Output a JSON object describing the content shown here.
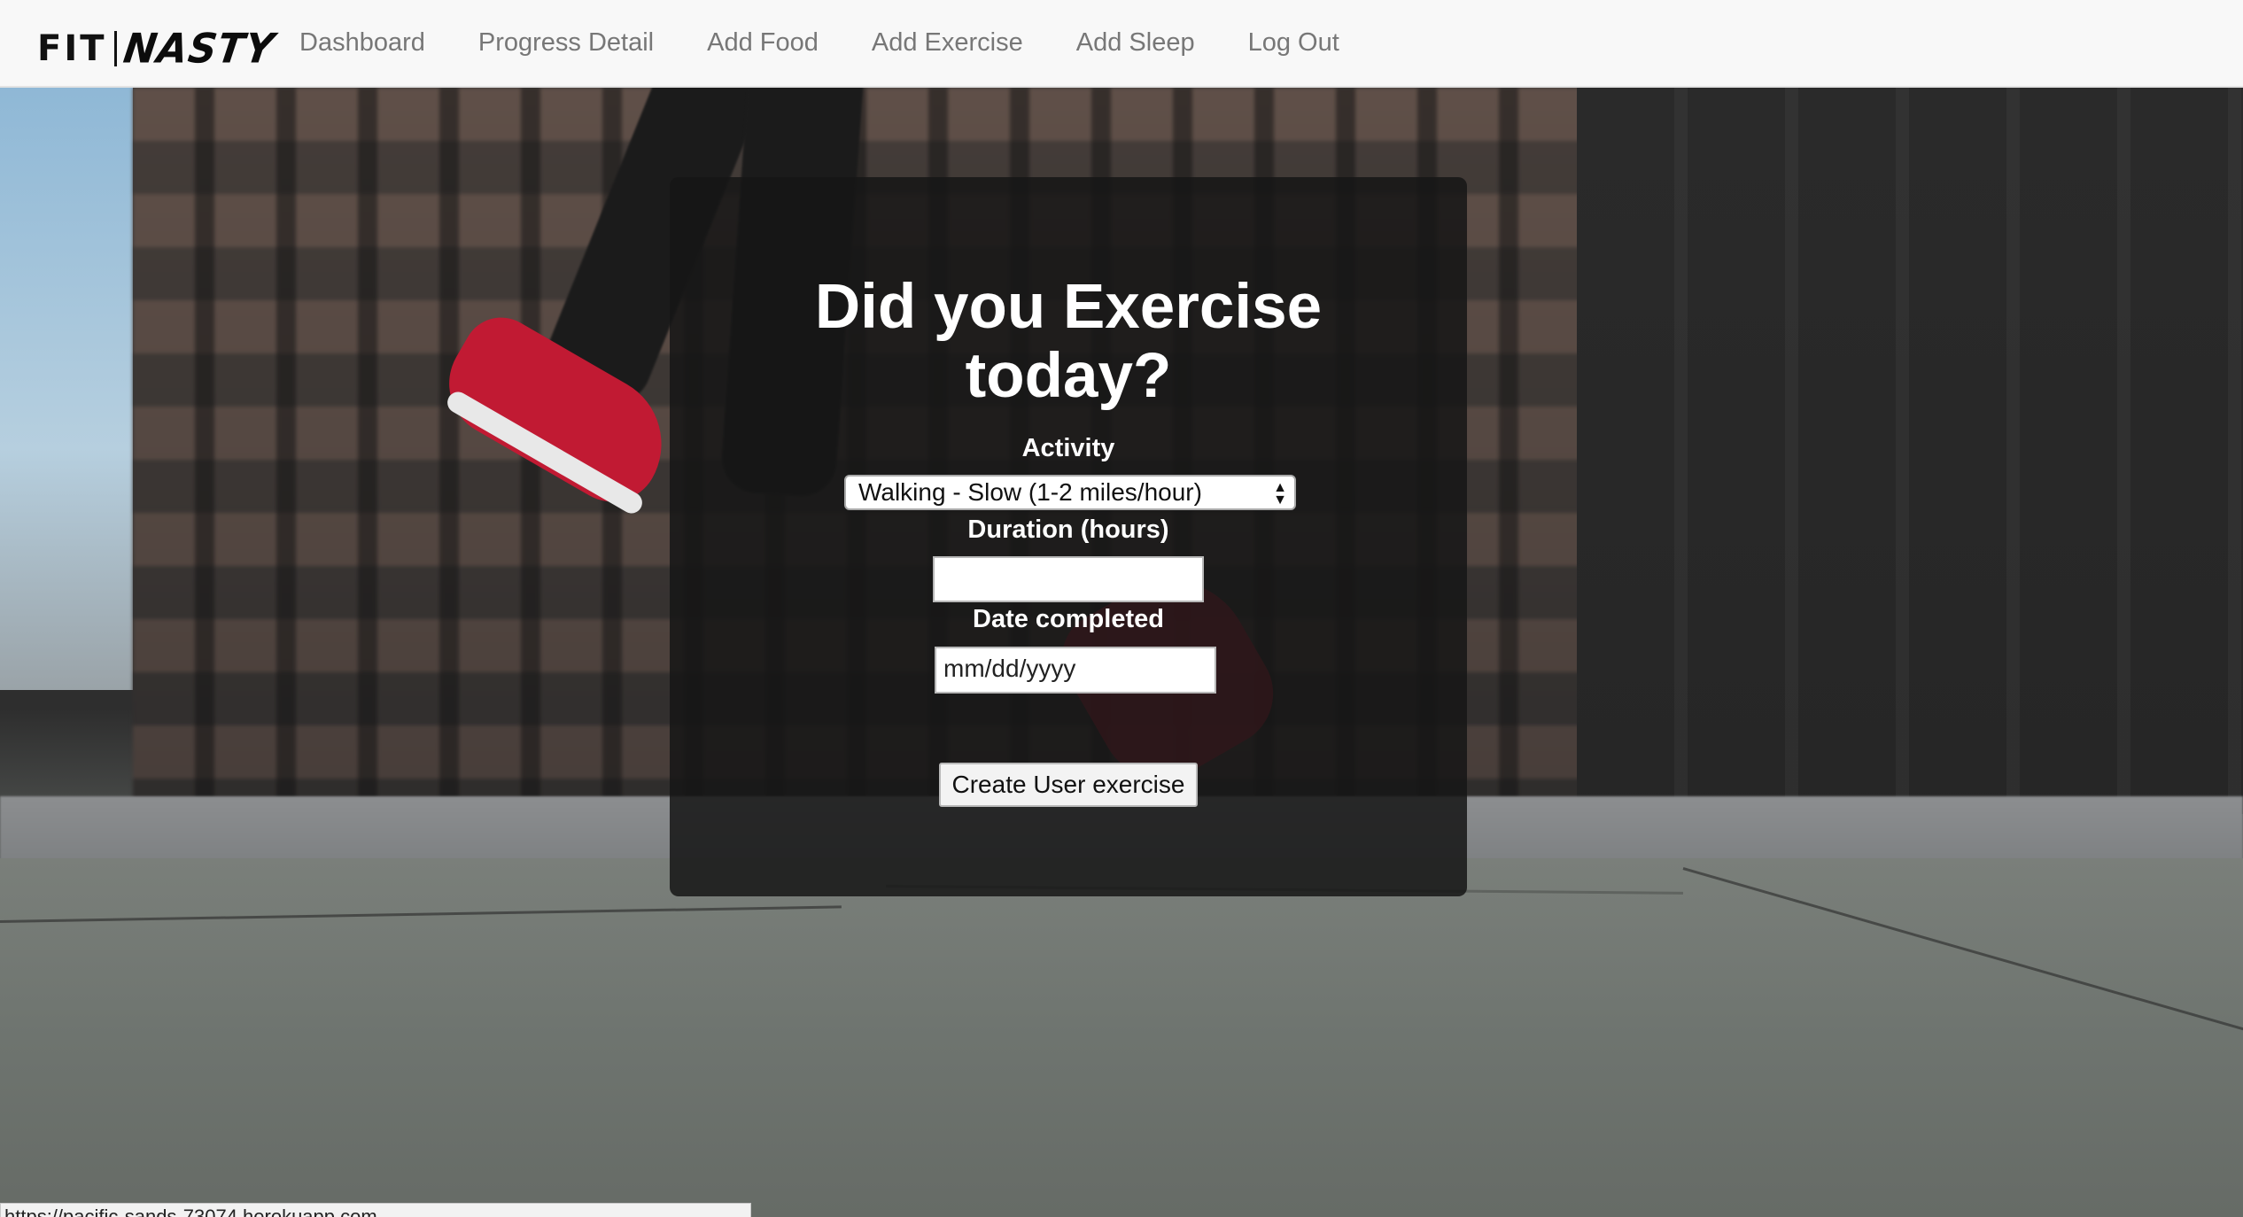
{
  "brand": {
    "left": "FIT",
    "right": "NASTY"
  },
  "nav": {
    "items": [
      {
        "label": "Dashboard"
      },
      {
        "label": "Progress Detail"
      },
      {
        "label": "Add Food"
      },
      {
        "label": "Add Exercise"
      },
      {
        "label": "Add Sleep"
      },
      {
        "label": "Log Out"
      }
    ]
  },
  "form": {
    "title_line1": "Did you Exercise",
    "title_line2": "today?",
    "activity_label": "Activity",
    "activity_selected": "Walking - Slow (1-2 miles/hour)",
    "duration_label": "Duration (hours)",
    "duration_value": "",
    "date_label": "Date completed",
    "date_placeholder": "mm/dd/yyyy",
    "submit_label": "Create User exercise"
  },
  "status_bar": {
    "url": "https://pacific-sands-73074.herokuapp.com"
  },
  "colors": {
    "navbar_bg": "#f8f8f8",
    "nav_text": "#777777",
    "panel_bg": "rgba(22,22,22,0.86)",
    "panel_text": "#ffffff",
    "shoe_accent": "#c11a33"
  }
}
